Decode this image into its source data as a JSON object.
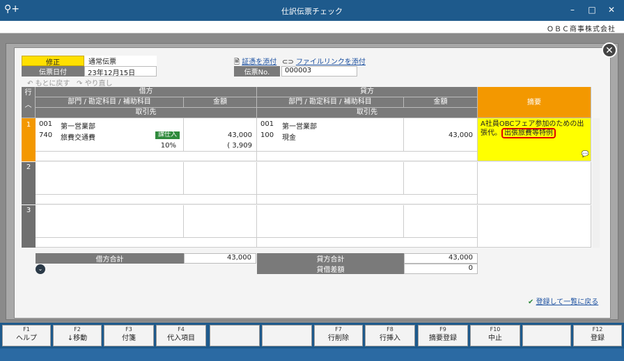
{
  "window": {
    "title": "仕訳伝票チェック",
    "company": "ＯＢＣ商事株式会社",
    "min": "–",
    "max": "□",
    "close": "✕"
  },
  "header": {
    "mode_label": "修正",
    "voucher_type": "通常伝票",
    "date_label": "伝票日付",
    "date_value": "23年12月15日",
    "undo": "もとに戻す",
    "redo": "やり直し",
    "attach_evidence": "証憑を添付",
    "attach_link": "ファイルリンクを添付",
    "voucher_no_label": "伝票No.",
    "voucher_no_value": "000003"
  },
  "grid": {
    "row_header": "行",
    "debit": "借方",
    "credit": "貸方",
    "dept_account": "部門 / 勘定科目 / 補助科目",
    "amount": "金額",
    "partner": "取引先",
    "memo": "摘要",
    "rows": [
      {
        "no": "1",
        "d_dept_code": "001",
        "d_dept": "第一営業部",
        "d_acct_code": "740",
        "d_acct": "旅費交通費",
        "d_tax_tag": "課仕入",
        "d_rate": "10%",
        "d_amount": "43,000",
        "d_tax": "( 3,909",
        "c_dept_code": "001",
        "c_dept": "第一営業部",
        "c_acct_code": "100",
        "c_acct": "現金",
        "c_amount": "43,000",
        "memo_text": "A社員OBCフェア参加のための出張代。",
        "memo_highlight": "出張旅費等特例"
      },
      {
        "no": "2"
      },
      {
        "no": "3"
      }
    ]
  },
  "totals": {
    "debit_total_label": "借方合計",
    "debit_total": "43,000",
    "credit_total_label": "貸方合計",
    "credit_total": "43,000",
    "diff_label": "貸借差額",
    "diff": "0"
  },
  "footer_link": "登録して一覧に戻る",
  "fkeys": [
    {
      "key": "F1",
      "label": "ヘルプ"
    },
    {
      "key": "F2",
      "label": "↓移動"
    },
    {
      "key": "F3",
      "label": "付箋"
    },
    {
      "key": "F4",
      "label": "代入項目"
    },
    {
      "key": "",
      "label": ""
    },
    {
      "key": "",
      "label": ""
    },
    {
      "key": "F7",
      "label": "行削除"
    },
    {
      "key": "F8",
      "label": "行挿入"
    },
    {
      "key": "F9",
      "label": "摘要登録"
    },
    {
      "key": "F10",
      "label": "中止"
    },
    {
      "key": "",
      "label": ""
    },
    {
      "key": "F12",
      "label": "登録"
    }
  ],
  "colors": {
    "accent": "#f39800",
    "title_bar": "#1e5a8c",
    "memo_bg": "#ffff00",
    "highlight_border": "#e00000"
  }
}
